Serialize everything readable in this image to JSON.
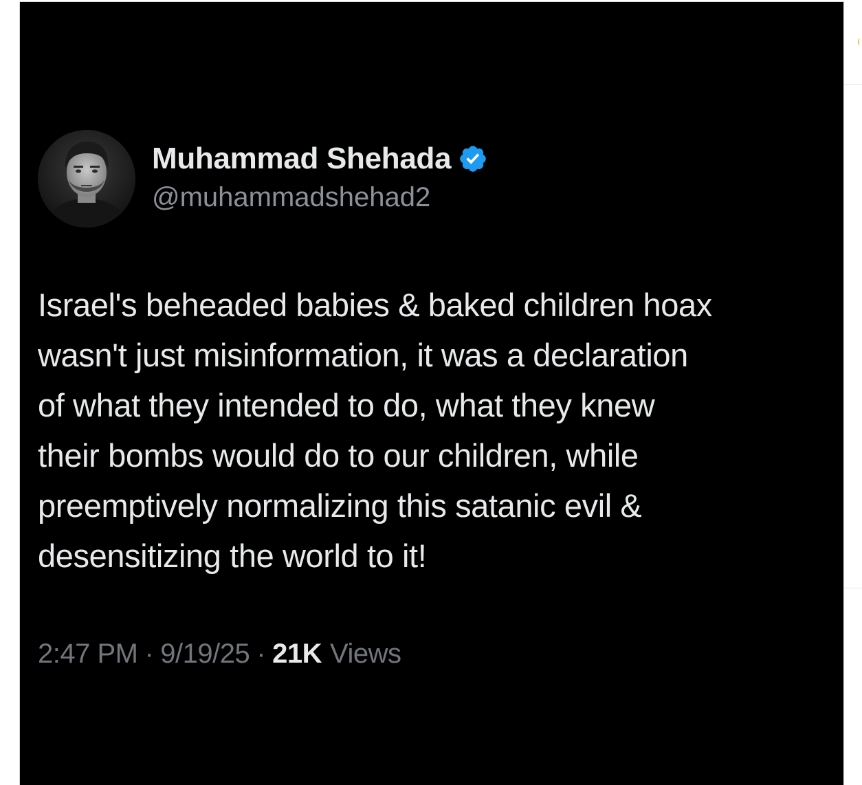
{
  "tweet": {
    "author": {
      "display_name": "Muhammad Shehada",
      "handle": "@muhammadshehad2",
      "verified": true,
      "verified_icon": "verified-check-icon",
      "avatar": "profile-photo"
    },
    "text_lines": [
      "Israel's beheaded babies & baked children hoax",
      "wasn't just misinformation, it was a declaration",
      "of what they intended to do, what they knew",
      "their bombs would do to our children, while",
      "preemptively normalizing this satanic evil &",
      "desensitizing the world to it!"
    ],
    "meta": {
      "time": "2:47 PM",
      "separator": "·",
      "date": "9/19/25",
      "views_count": "21K",
      "views_label": "Views"
    }
  },
  "colors": {
    "background": "#000000",
    "primary_text": "#e7e9ea",
    "secondary_text": "#71767b",
    "verified_blue": "#1d9bf0"
  }
}
